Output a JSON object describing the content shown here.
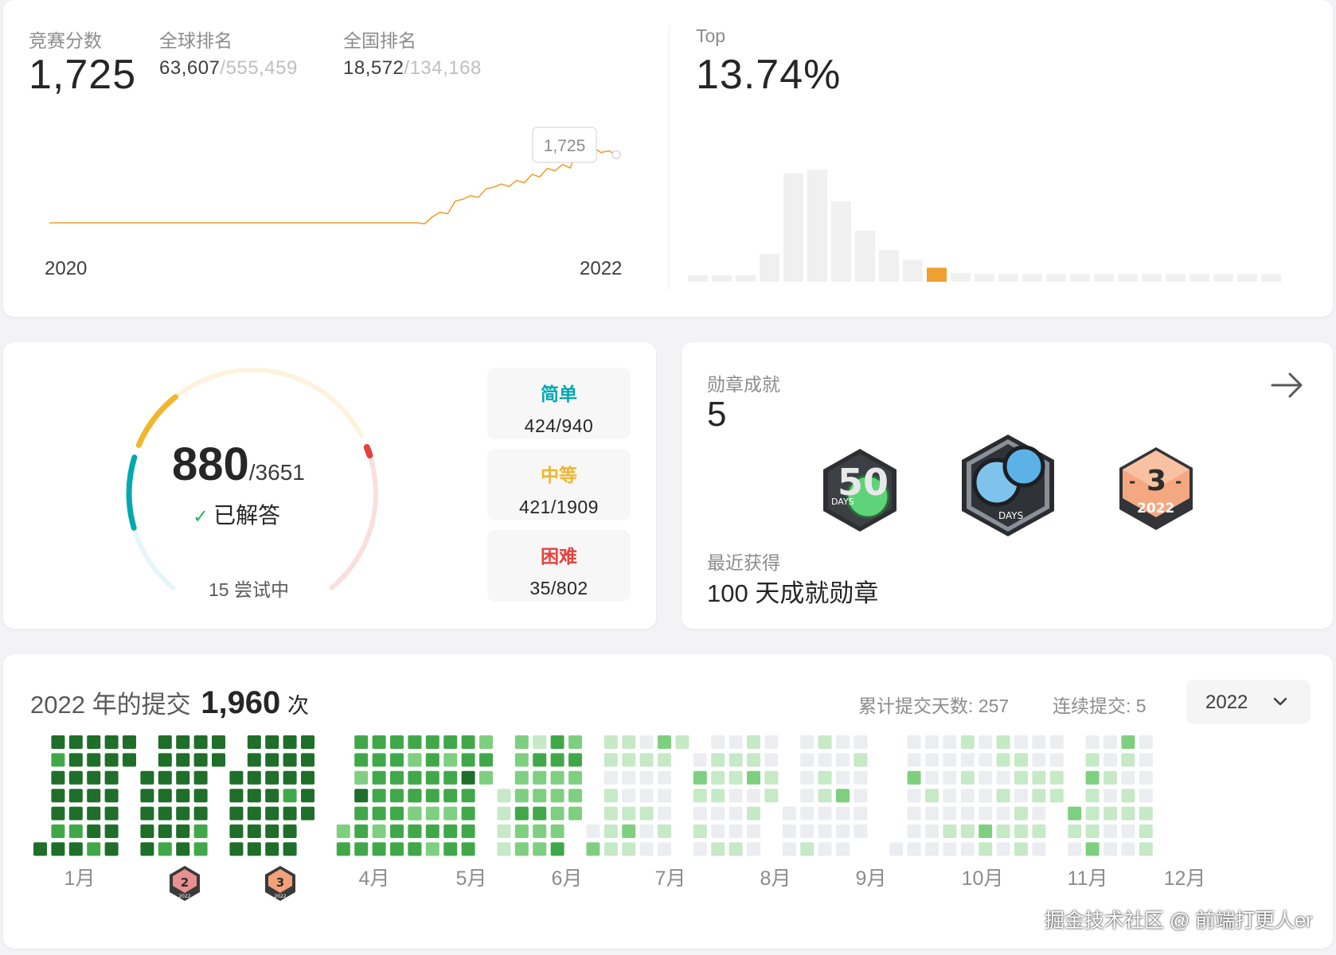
{
  "contest": {
    "score_label": "竞赛分数",
    "score": "1,725",
    "global_label": "全球排名",
    "global_rank": "63,607",
    "global_total": "/555,459",
    "national_label": "全国排名",
    "national_rank": "18,572",
    "national_total": "/134,168",
    "tooltip_value": "1,725",
    "year_start": "2020",
    "year_end": "2022",
    "top_label": "Top",
    "top_value": "13.74%",
    "rating_history": [
      1500,
      1500,
      1500,
      1500,
      1500,
      1500,
      1500,
      1500,
      1500,
      1500,
      1500,
      1500,
      1500,
      1500,
      1500,
      1500,
      1500,
      1500,
      1500,
      1500,
      1500,
      1500,
      1500,
      1500,
      1500,
      1500,
      1500,
      1500,
      1500,
      1500,
      1500,
      1500,
      1500,
      1500,
      1500,
      1500,
      1500,
      1500,
      1500,
      1500,
      1500,
      1500,
      1500,
      1500,
      1500,
      1500,
      1500,
      1500,
      1500,
      1497,
      1520,
      1535,
      1530,
      1572,
      1578,
      1590,
      1584,
      1612,
      1618,
      1628,
      1620,
      1640,
      1632,
      1660,
      1652,
      1680,
      1672,
      1693,
      1681,
      1755,
      1742,
      1749,
      1732,
      1738,
      1725
    ],
    "distribution": [
      0.05,
      0.05,
      0.05,
      0.22,
      0.85,
      0.88,
      0.63,
      0.4,
      0.25,
      0.17,
      0.11,
      0.07,
      0.06,
      0.06,
      0.06,
      0.06,
      0.06,
      0.06,
      0.06,
      0.06,
      0.06,
      0.06,
      0.06,
      0.06,
      0.06
    ],
    "distribution_highlight_index": 10,
    "colors": {
      "line": "#f0a030",
      "bar": "#f0f0f0",
      "highlight": "#f0a030"
    }
  },
  "problems": {
    "solved": "880",
    "total": "/3651",
    "solved_label": "已解答",
    "attempting": "15 尝试中",
    "easy_label": "简单",
    "easy_value": "424/940",
    "medium_label": "中等",
    "medium_value": "421/1909",
    "hard_label": "困难",
    "hard_value": "35/802",
    "easy_ratio": 0.451,
    "medium_ratio": 0.2205,
    "hard_ratio": 0.0436,
    "colors": {
      "easy": "#00a8b0",
      "easy_track": "#e6f6f7",
      "medium": "#f2b52b",
      "medium_track": "#fdf3dd",
      "hard": "#e4423d",
      "hard_track": "#fadfdf"
    }
  },
  "badges": {
    "title": "勋章成就",
    "count": "5",
    "recent_label": "最近获得",
    "recent_name": "100 天成就勋章",
    "badge1_text": "50",
    "badge1_days": "DAYS",
    "badge2_days": "DAYS",
    "badge3_num": "3",
    "badge3_year": "2022"
  },
  "submissions": {
    "title_prefix": "2022 年的提交",
    "count": "1,960",
    "unit": "次",
    "total_days_label": "累计提交天数: 257",
    "streak_label": "连续提交: 5",
    "year": "2022",
    "months": [
      "1月",
      "",
      "",
      "4月",
      "5月",
      "6月",
      "7月",
      "8月",
      "9月",
      "10月",
      "11月",
      "12月"
    ],
    "month_badge_2": "2",
    "month_badge_3": "3",
    "month_badge_year": "2022",
    "heat_levels": [
      4,
      4,
      4,
      3,
      3,
      2,
      1,
      1,
      0,
      0,
      1,
      1
    ],
    "heat_colors": [
      "#ebedf0",
      "#c6e9c6",
      "#7fcf80",
      "#41a84a",
      "#1f6e2a"
    ]
  },
  "watermark": "掘金技术社区 @ 前端打更人er"
}
